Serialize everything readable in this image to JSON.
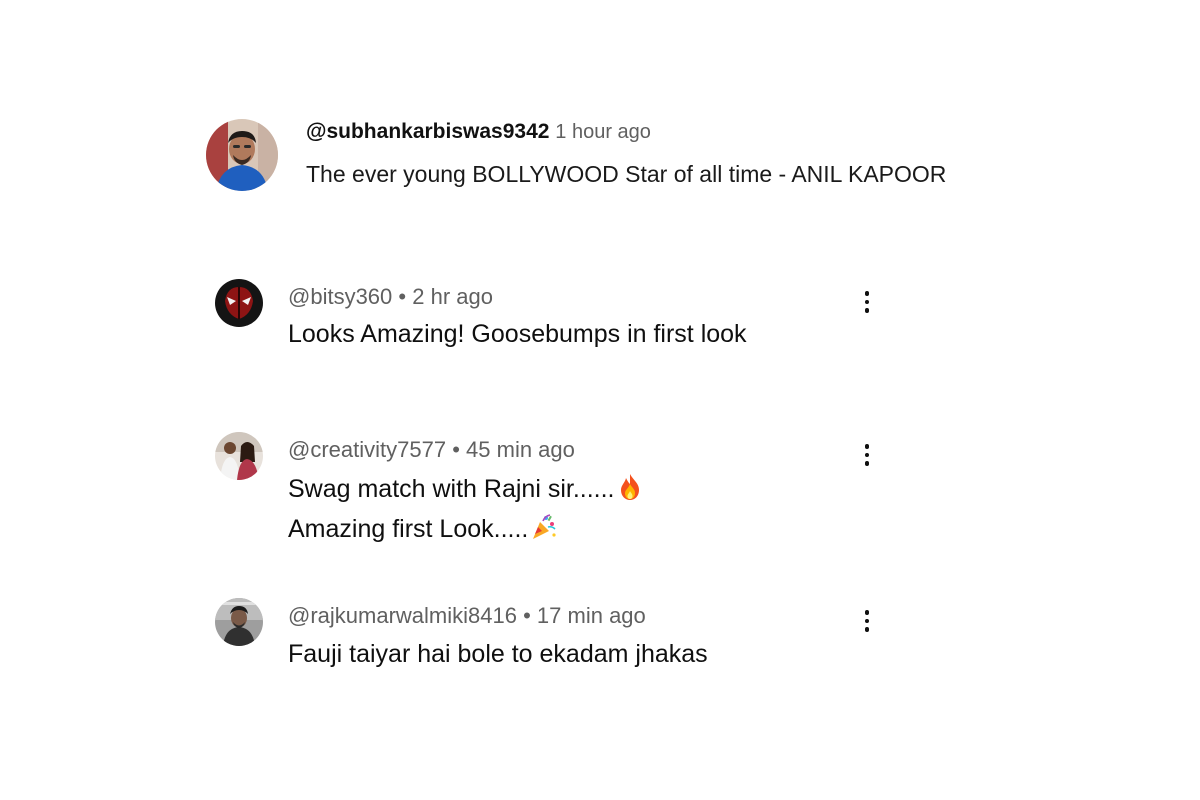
{
  "comments": [
    {
      "handle": "@subhankarbiswas9342",
      "time": "1 hour ago",
      "text": "The ever young BOLLYWOOD Star of all time - ANIL KAPOOR",
      "has_menu": false
    },
    {
      "handle": "@bitsy360",
      "separator": "•",
      "time": "2 hr ago",
      "text": "Looks Amazing! Goosebumps in first look",
      "has_menu": true
    },
    {
      "handle": "@creativity7577",
      "separator": "•",
      "time": "45 min ago",
      "lines": [
        "Swag match with Rajni sir......",
        "Amazing first Look....."
      ],
      "emojis": [
        "fire-emoji",
        "party-popper-emoji"
      ],
      "has_menu": true
    },
    {
      "handle": "@rajkumarwalmiki8416",
      "separator": "•",
      "time": "17 min ago",
      "text": "Fauji taiyar hai bole to ekadam jhakas",
      "has_menu": true
    }
  ],
  "icons": {
    "menu": "more-vert-icon"
  },
  "colors": {
    "text": "#0f0f0f",
    "meta": "#606060",
    "background": "#ffffff"
  }
}
